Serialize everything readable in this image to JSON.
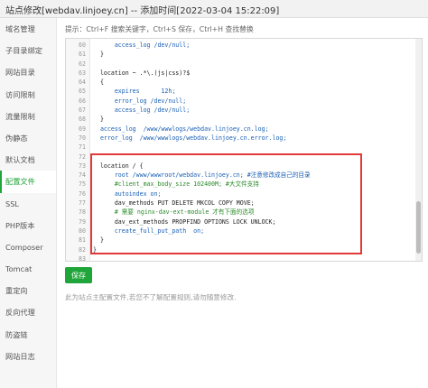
{
  "window": {
    "title": "站点修改[webdav.linjoey.cn] -- 添加时间[2022-03-04 15:22:09]"
  },
  "sidebar": {
    "items": [
      {
        "label": "域名管理"
      },
      {
        "label": "子目录绑定"
      },
      {
        "label": "网站目录"
      },
      {
        "label": "访问限制"
      },
      {
        "label": "流量限制"
      },
      {
        "label": "伪静态"
      },
      {
        "label": "默认文档"
      },
      {
        "label": "配置文件",
        "active": true
      },
      {
        "label": "SSL"
      },
      {
        "label": "PHP版本"
      },
      {
        "label": "Composer"
      },
      {
        "label": "Tomcat"
      },
      {
        "label": "重定向"
      },
      {
        "label": "反向代理"
      },
      {
        "label": "防盗链"
      },
      {
        "label": "网站日志"
      }
    ]
  },
  "hint": "提示：Ctrl+F 搜索关键字，Ctrl+S 保存，Ctrl+H 查找替换",
  "editor": {
    "lines": [
      {
        "num": "60",
        "code": "      access_log /dev/null;",
        "style": "blue"
      },
      {
        "num": "61",
        "code": "  }",
        "style": "dark"
      },
      {
        "num": "62",
        "code": "",
        "style": "dark"
      },
      {
        "num": "63",
        "code": "  location ~ .*\\.(js|css)?$",
        "style": "dark"
      },
      {
        "num": "64",
        "code": "  {",
        "style": "dark"
      },
      {
        "num": "65",
        "code": "      expires      12h;",
        "style": "blue"
      },
      {
        "num": "66",
        "code": "      error_log /dev/null;",
        "style": "blue"
      },
      {
        "num": "67",
        "code": "      access_log /dev/null;",
        "style": "blue"
      },
      {
        "num": "68",
        "code": "  }",
        "style": "dark"
      },
      {
        "num": "69",
        "code": "  access_log  /www/wwwlogs/webdav.linjoey.cn.log;",
        "style": "blue"
      },
      {
        "num": "70",
        "code": "  error_log  /www/wwwlogs/webdav.linjoey.cn.error.log;",
        "style": "blue"
      },
      {
        "num": "71",
        "code": "",
        "style": "dark"
      },
      {
        "num": "72",
        "code": "",
        "style": "dark"
      },
      {
        "num": "73",
        "code": "  location / {",
        "style": "dark"
      },
      {
        "num": "74",
        "code": "      root /www/wwwroot/webdav.linjoey.cn; #注意修改成自己的目录",
        "style": "blue"
      },
      {
        "num": "75",
        "code": "      #client_max_body_size 102400M; #大文件支持",
        "style": "cmt"
      },
      {
        "num": "76",
        "code": "      autoindex on;",
        "style": "blue"
      },
      {
        "num": "77",
        "code": "      dav_methods PUT DELETE MKCOL COPY MOVE;",
        "style": "dark"
      },
      {
        "num": "78",
        "code": "      # 需要 nginx-dav-ext-module 才有下面的选项",
        "style": "cmt"
      },
      {
        "num": "79",
        "code": "      dav_ext_methods PROPFIND OPTIONS LOCK UNLOCK;",
        "style": "dark"
      },
      {
        "num": "80",
        "code": "      create_full_put_path  on;",
        "style": "blue"
      },
      {
        "num": "81",
        "code": "  }",
        "style": "dark"
      },
      {
        "num": "82",
        "code": "}",
        "style": "dark"
      },
      {
        "num": "83",
        "code": "",
        "style": "dark"
      }
    ]
  },
  "save_label": "保存",
  "note": "此为站点主配置文件,若您不了解配置规则,请勿随意修改."
}
